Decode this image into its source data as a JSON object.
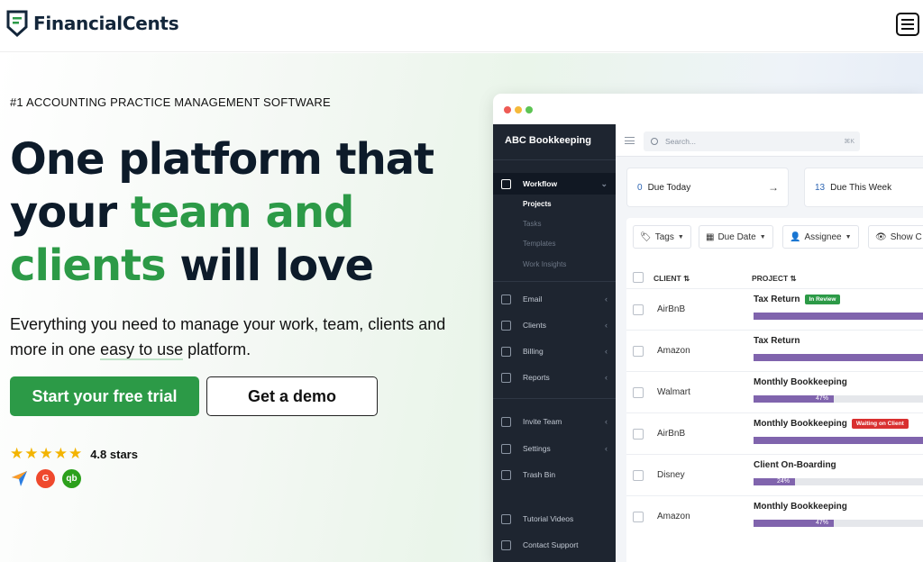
{
  "header": {
    "brand": "FinancialCents",
    "menu_icon": "hamburger-menu-icon"
  },
  "hero": {
    "eyebrow": "#1 ACCOUNTING PRACTICE MANAGEMENT SOFTWARE",
    "headline_line1": "One platform that",
    "headline_line2_a": "your ",
    "headline_line2_b": "team and",
    "headline_line3_a": "clients",
    "headline_line3_b": " will love",
    "subline_a": "Everything you need to manage your work, team, clients and more in one ",
    "subline_b": "easy to use",
    "subline_c": " platform.",
    "cta_primary": "Start your free trial",
    "cta_secondary": "Get a demo",
    "stars": "★★★★★",
    "rating_text": "4.8 stars",
    "rating_value": 4.8,
    "badges": [
      "capterra-icon",
      "g2-icon",
      "quickbooks-icon"
    ],
    "colors": {
      "green": "#2c9a47",
      "navy": "#0d1b2a"
    }
  },
  "app": {
    "org_name": "ABC Bookkeeping",
    "nav": {
      "workflow": "Workflow",
      "sub_projects": "Projects",
      "sub_tasks": "Tasks",
      "sub_templates": "Templates",
      "sub_insights": "Work Insights",
      "email": "Email",
      "clients": "Clients",
      "billing": "Billing",
      "reports": "Reports",
      "invite": "Invite Team",
      "settings": "Settings",
      "trash": "Trash Bin",
      "tutorials": "Tutorial Videos",
      "support": "Contact Support"
    },
    "search_placeholder": "Search...",
    "search_shortcut": "⌘K",
    "cards": [
      {
        "count": "0",
        "label": "Due Today"
      },
      {
        "count": "13",
        "label": "Due This Week"
      }
    ],
    "filters": [
      "Tags",
      "Due Date",
      "Assignee",
      "Show C"
    ],
    "columns": {
      "client": "CLIENT",
      "project": "PROJECT"
    },
    "rows": [
      {
        "client": "AirBnB",
        "project": "Tax Return",
        "tag": "In Review",
        "tag_color": "#2c9a47",
        "progress": 1.0,
        "pct_label": ""
      },
      {
        "client": "Amazon",
        "project": "Tax Return",
        "tag": "",
        "progress": 1.0,
        "pct_label": ""
      },
      {
        "client": "Walmart",
        "project": "Monthly Bookkeeping",
        "tag": "",
        "progress": 0.47,
        "pct_label": "47%"
      },
      {
        "client": "AirBnB",
        "project": "Monthly Bookkeeping",
        "tag": "Waiting on Client",
        "tag_color": "#d93030",
        "progress": 1.0,
        "pct_label": ""
      },
      {
        "client": "Disney",
        "project": "Client On-Boarding",
        "tag": "",
        "progress": 0.24,
        "pct_label": "24%"
      },
      {
        "client": "Amazon",
        "project": "Monthly Bookkeeping",
        "tag": "",
        "progress": 0.47,
        "pct_label": "47%"
      }
    ]
  }
}
